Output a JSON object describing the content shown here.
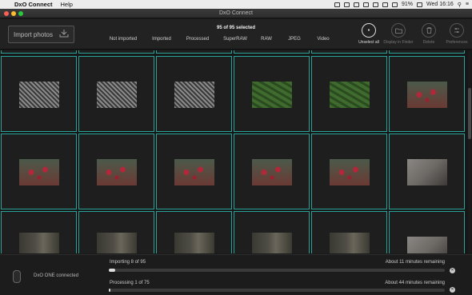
{
  "menubar": {
    "app_name": "DxO Connect",
    "menus": [
      "Help"
    ],
    "battery": "91%",
    "clock": "Wed 16:16"
  },
  "window": {
    "title": "DxO Connect"
  },
  "toolbar": {
    "import_label": "Import photos",
    "selection_text": "95 of 95 selected",
    "filters": [
      "Not imported",
      "Imported",
      "Processed",
      "SuperRAW",
      "RAW",
      "JPEG",
      "Video"
    ],
    "actions": [
      {
        "label": "Unselect all",
        "icon": "circle-dot-icon"
      },
      {
        "label": "Display in Finder",
        "icon": "folder-icon"
      },
      {
        "label": "Delete",
        "icon": "trash-icon"
      },
      {
        "label": "Preferences",
        "icon": "sliders-icon"
      }
    ]
  },
  "grid": {
    "rows": [
      [
        "ornament",
        "ornament",
        "ornament",
        "leaves",
        "leaves",
        "berries"
      ],
      [
        "berries",
        "berries",
        "berries",
        "berries",
        "berries",
        "bark"
      ],
      [
        "trunk",
        "trunk",
        "trunk",
        "trunk",
        "trunk",
        "bark"
      ]
    ],
    "thumb_colors": {
      "ornament": "#8a8a8a",
      "leaves": "#3f6b2e",
      "berries": "#6a3a34",
      "bark": "#6e6a66",
      "trunk": "#4e4c45"
    },
    "selection_color": "#2aa39a"
  },
  "footer": {
    "device_status": "DxO ONE connected",
    "import_label": "Importing 8 of 95",
    "import_remaining": "About 11 minutes remaining",
    "import_progress": 0.02,
    "process_label": "Processing 1 of 75",
    "process_remaining": "About 44 minutes remaining",
    "process_progress": 0.005
  }
}
